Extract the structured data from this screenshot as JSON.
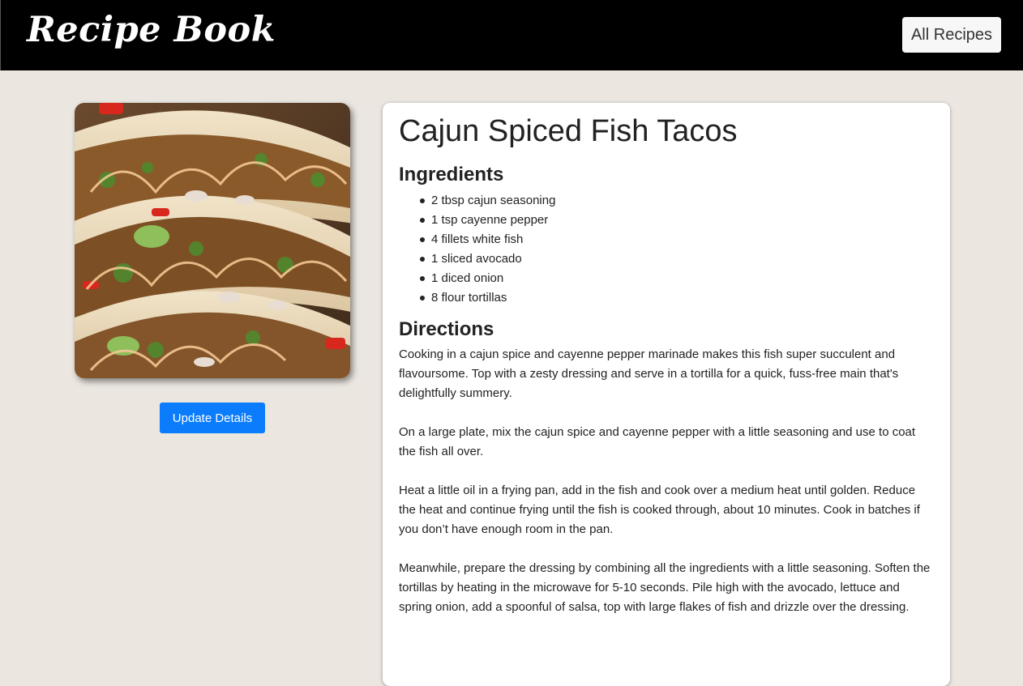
{
  "header": {
    "brand": "Recipe Book",
    "all_recipes_label": "All Recipes"
  },
  "sidebar": {
    "image_alt": "Cajun spiced fish tacos photo",
    "update_label": "Update Details"
  },
  "recipe": {
    "title": "Cajun Spiced Fish Tacos",
    "ingredients_heading": "Ingredients",
    "ingredients": [
      "2 tbsp cajun seasoning",
      "1 tsp cayenne pepper",
      "4 fillets white fish",
      "1 sliced avocado",
      "1 diced onion",
      "8 flour tortillas"
    ],
    "directions_heading": "Directions",
    "directions": [
      "Cooking in a cajun spice and cayenne pepper marinade makes this fish super succulent and flavoursome. Top with a zesty dressing and serve in a tortilla for a quick, fuss-free main that's delightfully summery.",
      "On a large plate, mix the cajun spice and cayenne pepper with a little seasoning and use to coat the fish all over.",
      "Heat a little oil in a frying pan, add in the fish and cook over a medium heat until golden. Reduce the heat and continue frying until the fish is cooked through, about 10 minutes. Cook in batches if you don’t have enough room in the pan.",
      "Meanwhile, prepare the dressing by combining all the ingredients with a little seasoning. Soften the tortillas by heating in the microwave for 5-10 seconds. Pile high with the avocado, lettuce and spring onion, add a spoonful of salsa, top with large flakes of fish and drizzle over the dressing."
    ]
  },
  "colors": {
    "navbar": "#000000",
    "page_background": "#ebe6e0",
    "primary_button": "#0b7dfc"
  }
}
